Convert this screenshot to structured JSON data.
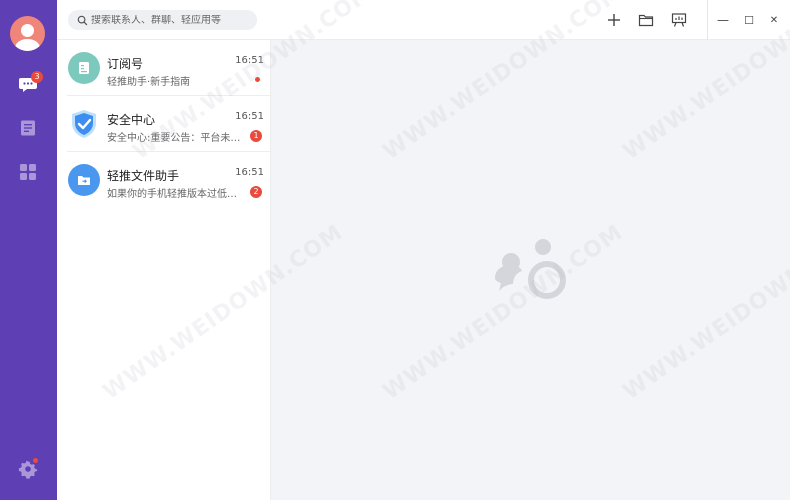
{
  "rail": {
    "messages_badge": "3",
    "colors": {
      "rail_bg": "#5e3fb4",
      "avatar_bg": "#f0867a",
      "badge": "#e84a3c"
    }
  },
  "topbar": {
    "search_placeholder": "搜索联系人、群聊、轻应用等",
    "icons": [
      "plus-icon",
      "folder-icon",
      "presentation-icon"
    ],
    "window": {
      "minimize": "—",
      "maximize": "☐",
      "close": "✕"
    }
  },
  "chats": [
    {
      "name": "订阅号",
      "time": "16:51",
      "preview": "轻推助手·新手指南",
      "badge": "",
      "dot": true,
      "icon": "subscription-icon",
      "color": "#7ec9bd"
    },
    {
      "name": "安全中心",
      "time": "16:51",
      "preview": "安全中心:重要公告：平台未经授权",
      "badge": "1",
      "dot": false,
      "icon": "shield-icon",
      "color": "#3d8ef0"
    },
    {
      "name": "轻推文件助手",
      "time": "16:51",
      "preview": "如果你的手机轻推版本过低，请升级",
      "badge": "2",
      "dot": false,
      "icon": "file-folder-icon",
      "color": "#4a97f0"
    }
  ],
  "watermark": "WWW.WEIDOWN.COM"
}
